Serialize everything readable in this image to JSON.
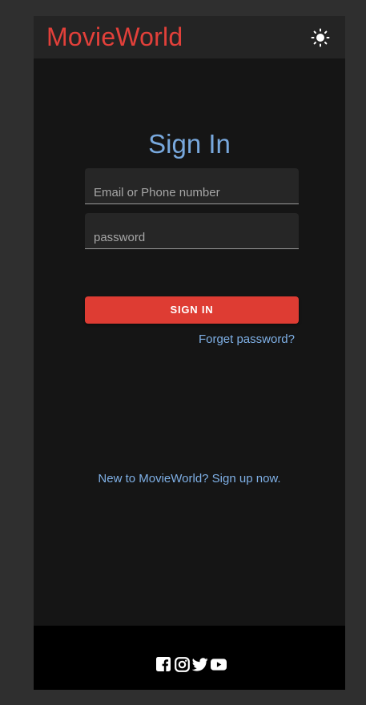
{
  "header": {
    "brand": "MovieWorld",
    "theme_icon": "sun-icon"
  },
  "form": {
    "title": "Sign In",
    "email_placeholder": "Email or Phone number",
    "email_value": "",
    "password_placeholder": "password",
    "password_value": "",
    "submit_label": "SIGN IN",
    "forgot_label": "Forget password?",
    "signup_label": "New to MovieWorld? Sign up now."
  },
  "footer": {
    "social": [
      "facebook-icon",
      "instagram-icon",
      "twitter-icon",
      "youtube-icon"
    ]
  },
  "colors": {
    "brand": "#e2403a",
    "accent": "#78a8dd",
    "link": "#7fb0e6",
    "button": "#de3c33",
    "background": "#151515",
    "header": "#242424",
    "footer": "#000000"
  }
}
